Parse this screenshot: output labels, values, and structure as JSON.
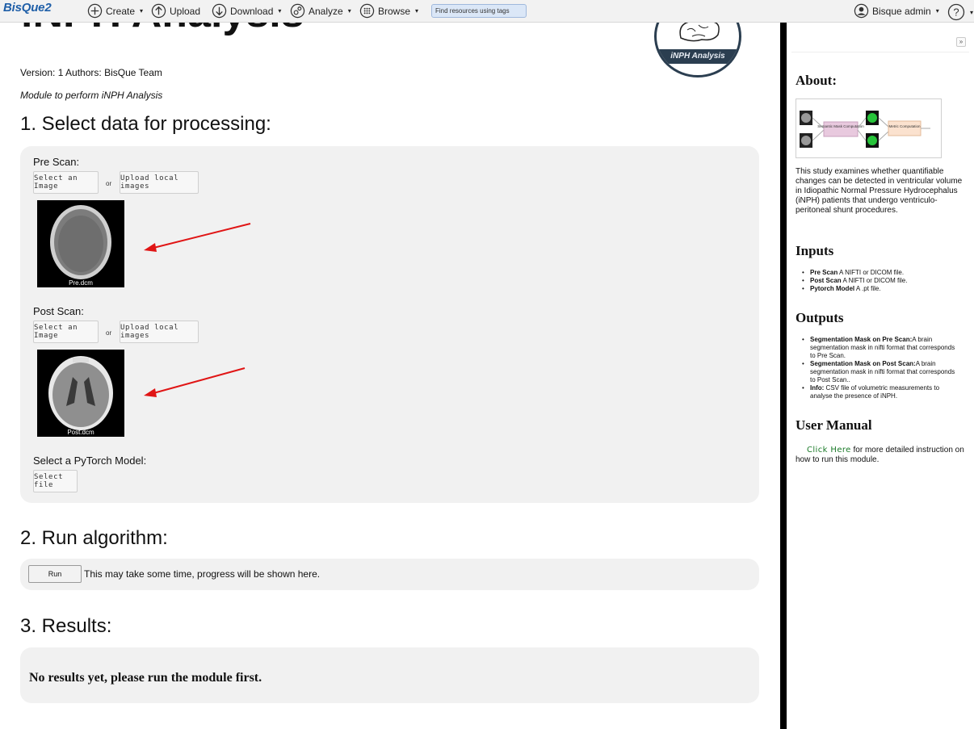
{
  "nav": {
    "brand": "BisQue2",
    "create": "Create",
    "upload": "Upload",
    "download": "Download",
    "analyze": "Analyze",
    "browse": "Browse",
    "tag_search_placeholder": "Find resources using tags",
    "user": "Bisque admin",
    "help": "?"
  },
  "module": {
    "title": "iNPH Analysis",
    "logo_caption": "iNPH Analysis",
    "meta": "Version: 1 Authors: BisQue Team",
    "description": "Module to perform iNPH Analysis",
    "section1_title": "1. Select data for processing:",
    "pre_scan_label": "Pre Scan:",
    "post_scan_label": "Post Scan:",
    "select_image_label": "Select an Image",
    "or_label": "or",
    "upload_local_label": "Upload local images",
    "pre_scan_file": "Pre.dcm",
    "post_scan_file": "Post.dcm",
    "model_label": "Select a PyTorch Model:",
    "select_file_label": "Select file",
    "section2_title": "2. Run algorithm:",
    "run_label": "Run",
    "run_note": "This may take some time, progress will be shown here.",
    "section3_title": "3. Results:",
    "no_results": "No results yet, please run the module first."
  },
  "side": {
    "collapse_icon": "»",
    "about_title": "About:",
    "about_text": "This study examines whether quantifiable changes can be detected in ventricular volume in Idiopathic Normal Pressure Hydrocephalus (iNPH) patients that undergo ventriculo-peritoneal shunt procedures.",
    "diagram": {
      "box1": "Semantic Mask Computation",
      "box2": "Metric Computation"
    },
    "inputs_title": "Inputs",
    "inputs": [
      {
        "name": "Pre Scan",
        "text": " A NIFTI or DICOM file."
      },
      {
        "name": "Post Scan",
        "text": " A NIFTI or DICOM file."
      },
      {
        "name": "Pytorch Model",
        "text": " A .pt file."
      }
    ],
    "outputs_title": "Outputs",
    "outputs": [
      {
        "name": "Segmentation Mask on Pre Scan:",
        "text": "A brain segmentation mask in nifti format that corresponds to Pre Scan."
      },
      {
        "name": "Segmentation Mask on Post Scan:",
        "text": "A brain segmentation mask in nifti format that corresponds to Post Scan.."
      },
      {
        "name": "Info:",
        "text": " CSV file of volumetric measurements to analyse the presence of iNPH."
      }
    ],
    "manual_title": "User Manual",
    "manual_link": "Click Here",
    "manual_text": " for more detailed instruction on how to run this module."
  },
  "colors": {
    "arrow": "#e01515",
    "link": "#1a7a28",
    "brand": "#1f5fa8"
  }
}
